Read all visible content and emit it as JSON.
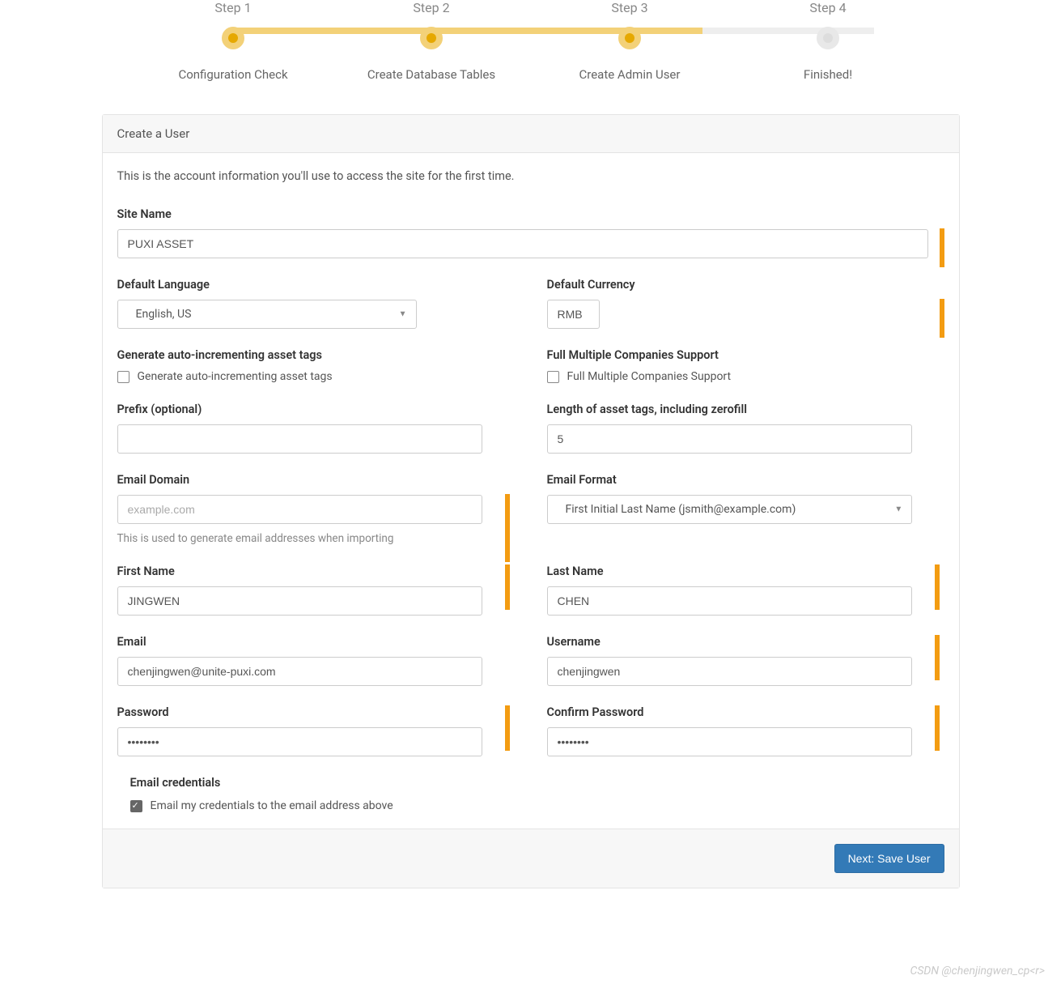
{
  "wizard": {
    "steps": [
      {
        "label": "Step 1",
        "sub": "Configuration Check"
      },
      {
        "label": "Step 2",
        "sub": "Create Database Tables"
      },
      {
        "label": "Step 3",
        "sub": "Create Admin User"
      },
      {
        "label": "Step 4",
        "sub": "Finished!"
      }
    ]
  },
  "panel": {
    "header": "Create a User",
    "intro": "This is the account information you'll use to access the site for the first time."
  },
  "form": {
    "site_name": {
      "label": "Site Name",
      "value": "PUXI ASSET"
    },
    "default_language": {
      "label": "Default Language",
      "value": "English, US"
    },
    "default_currency": {
      "label": "Default Currency",
      "value": "RMB"
    },
    "auto_increment": {
      "label": "Generate auto-incrementing asset tags",
      "checkbox_label": "Generate auto-incrementing asset tags"
    },
    "multi_companies": {
      "label": "Full Multiple Companies Support",
      "checkbox_label": "Full Multiple Companies Support"
    },
    "prefix": {
      "label": "Prefix (optional)",
      "value": ""
    },
    "tag_length": {
      "label": "Length of asset tags, including zerofill",
      "value": "5"
    },
    "email_domain": {
      "label": "Email Domain",
      "placeholder": "example.com",
      "help": "This is used to generate email addresses when importing"
    },
    "email_format": {
      "label": "Email Format",
      "value": "First Initial Last Name (jsmith@example.com)"
    },
    "first_name": {
      "label": "First Name",
      "value": "JINGWEN"
    },
    "last_name": {
      "label": "Last Name",
      "value": "CHEN"
    },
    "email": {
      "label": "Email",
      "value": "chenjingwen@unite-puxi.com"
    },
    "username": {
      "label": "Username",
      "value": "chenjingwen"
    },
    "password": {
      "label": "Password",
      "value": "••••••••"
    },
    "confirm_password": {
      "label": "Confirm Password",
      "value": "••••••••"
    },
    "email_credentials": {
      "label": "Email credentials",
      "checkbox_label": "Email my credentials to the email address above"
    }
  },
  "footer": {
    "button": "Next: Save User"
  },
  "watermark": "CSDN @chenjingwen_cp<r>"
}
